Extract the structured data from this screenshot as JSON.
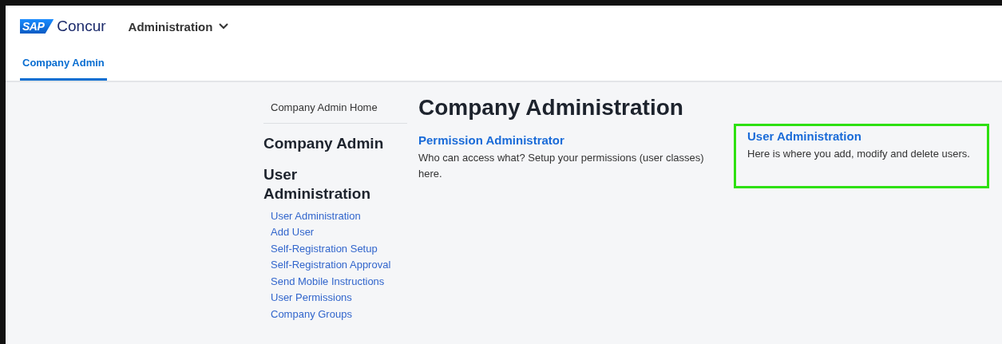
{
  "header": {
    "logo": {
      "mark": "SAP",
      "name": "Concur"
    },
    "menu": {
      "label": "Administration"
    }
  },
  "tabs": [
    {
      "label": "Company Admin",
      "selected": true
    }
  ],
  "sidebar": {
    "home_link": "Company Admin Home",
    "title": "Company Admin",
    "section_title": "User Administration",
    "items": [
      "User Administration",
      "Add User",
      "Self-Registration Setup",
      "Self-Registration Approval",
      "Send Mobile Instructions",
      "User Permissions",
      "Company Groups"
    ]
  },
  "page_title": "Company Administration",
  "cards": [
    {
      "title": "Permission Administrator",
      "description": "Who can access what? Setup your permissions (user classes) here.",
      "highlighted": false
    },
    {
      "title": "User Administration",
      "description": "Here is where you add, modify and delete users.",
      "highlighted": true
    }
  ]
}
